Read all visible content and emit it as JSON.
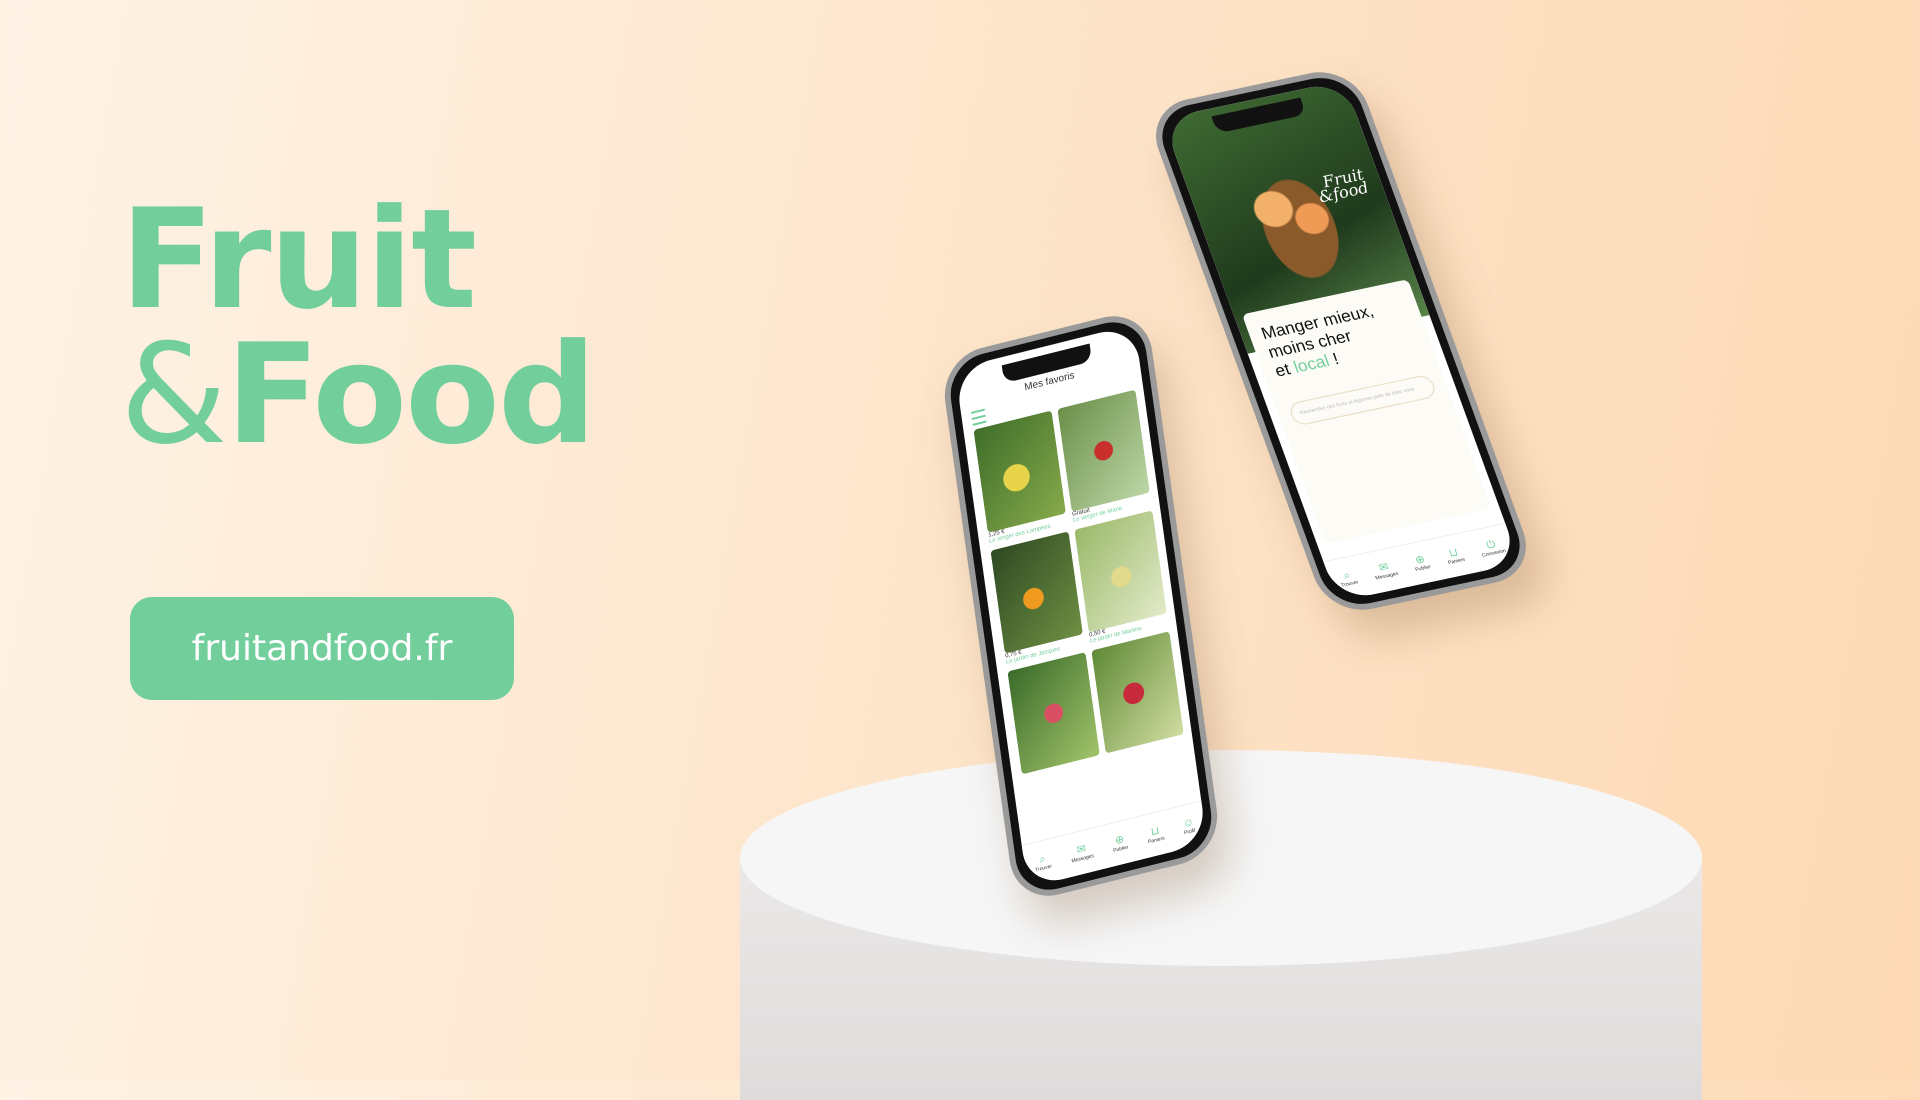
{
  "brand": {
    "line1": "Fruit",
    "amp": "&",
    "line2": "Food"
  },
  "site_button": {
    "label": "fruitandfood.fr"
  },
  "phone_favorites": {
    "title": "Mes favoris",
    "cards": [
      {
        "meta": "1,25 €",
        "name": "Le verger des Lampées"
      },
      {
        "meta": "Gratuit",
        "name": "Le verger de Marie"
      },
      {
        "meta": "",
        "name": ""
      },
      {
        "meta": "",
        "name": ""
      },
      {
        "meta": "0,75 €",
        "name": "Le jardin de Jacques"
      },
      {
        "meta": "0,50 €",
        "name": "Le jardin de Martine"
      }
    ],
    "tabs": [
      {
        "icon": "search-icon",
        "label": "Trouver"
      },
      {
        "icon": "mail-icon",
        "label": "Messages"
      },
      {
        "icon": "plus-icon",
        "label": "Publier"
      },
      {
        "icon": "basket-icon",
        "label": "Paniers"
      },
      {
        "icon": "profile-icon",
        "label": "Profil"
      }
    ]
  },
  "phone_home": {
    "logo_line1": "Fruit",
    "logo_line2": "&food",
    "headline_1": "Manger mieux,",
    "headline_2": "moins cher",
    "headline_3_prefix": "et ",
    "headline_3_accent": "local",
    "headline_3_suffix": " !",
    "search_placeholder": "Rechercher des fruits et légumes près de chez vous",
    "tabs": [
      {
        "icon": "search-icon",
        "label": "Trouver"
      },
      {
        "icon": "mail-icon",
        "label": "Messages"
      },
      {
        "icon": "plus-icon",
        "label": "Publier"
      },
      {
        "icon": "basket-icon",
        "label": "Paniers"
      },
      {
        "icon": "power-icon",
        "label": "Connexion"
      }
    ]
  },
  "colors": {
    "accent": "#72cf9c",
    "background": "#fde6cc",
    "podium": "#f6f6f6"
  }
}
